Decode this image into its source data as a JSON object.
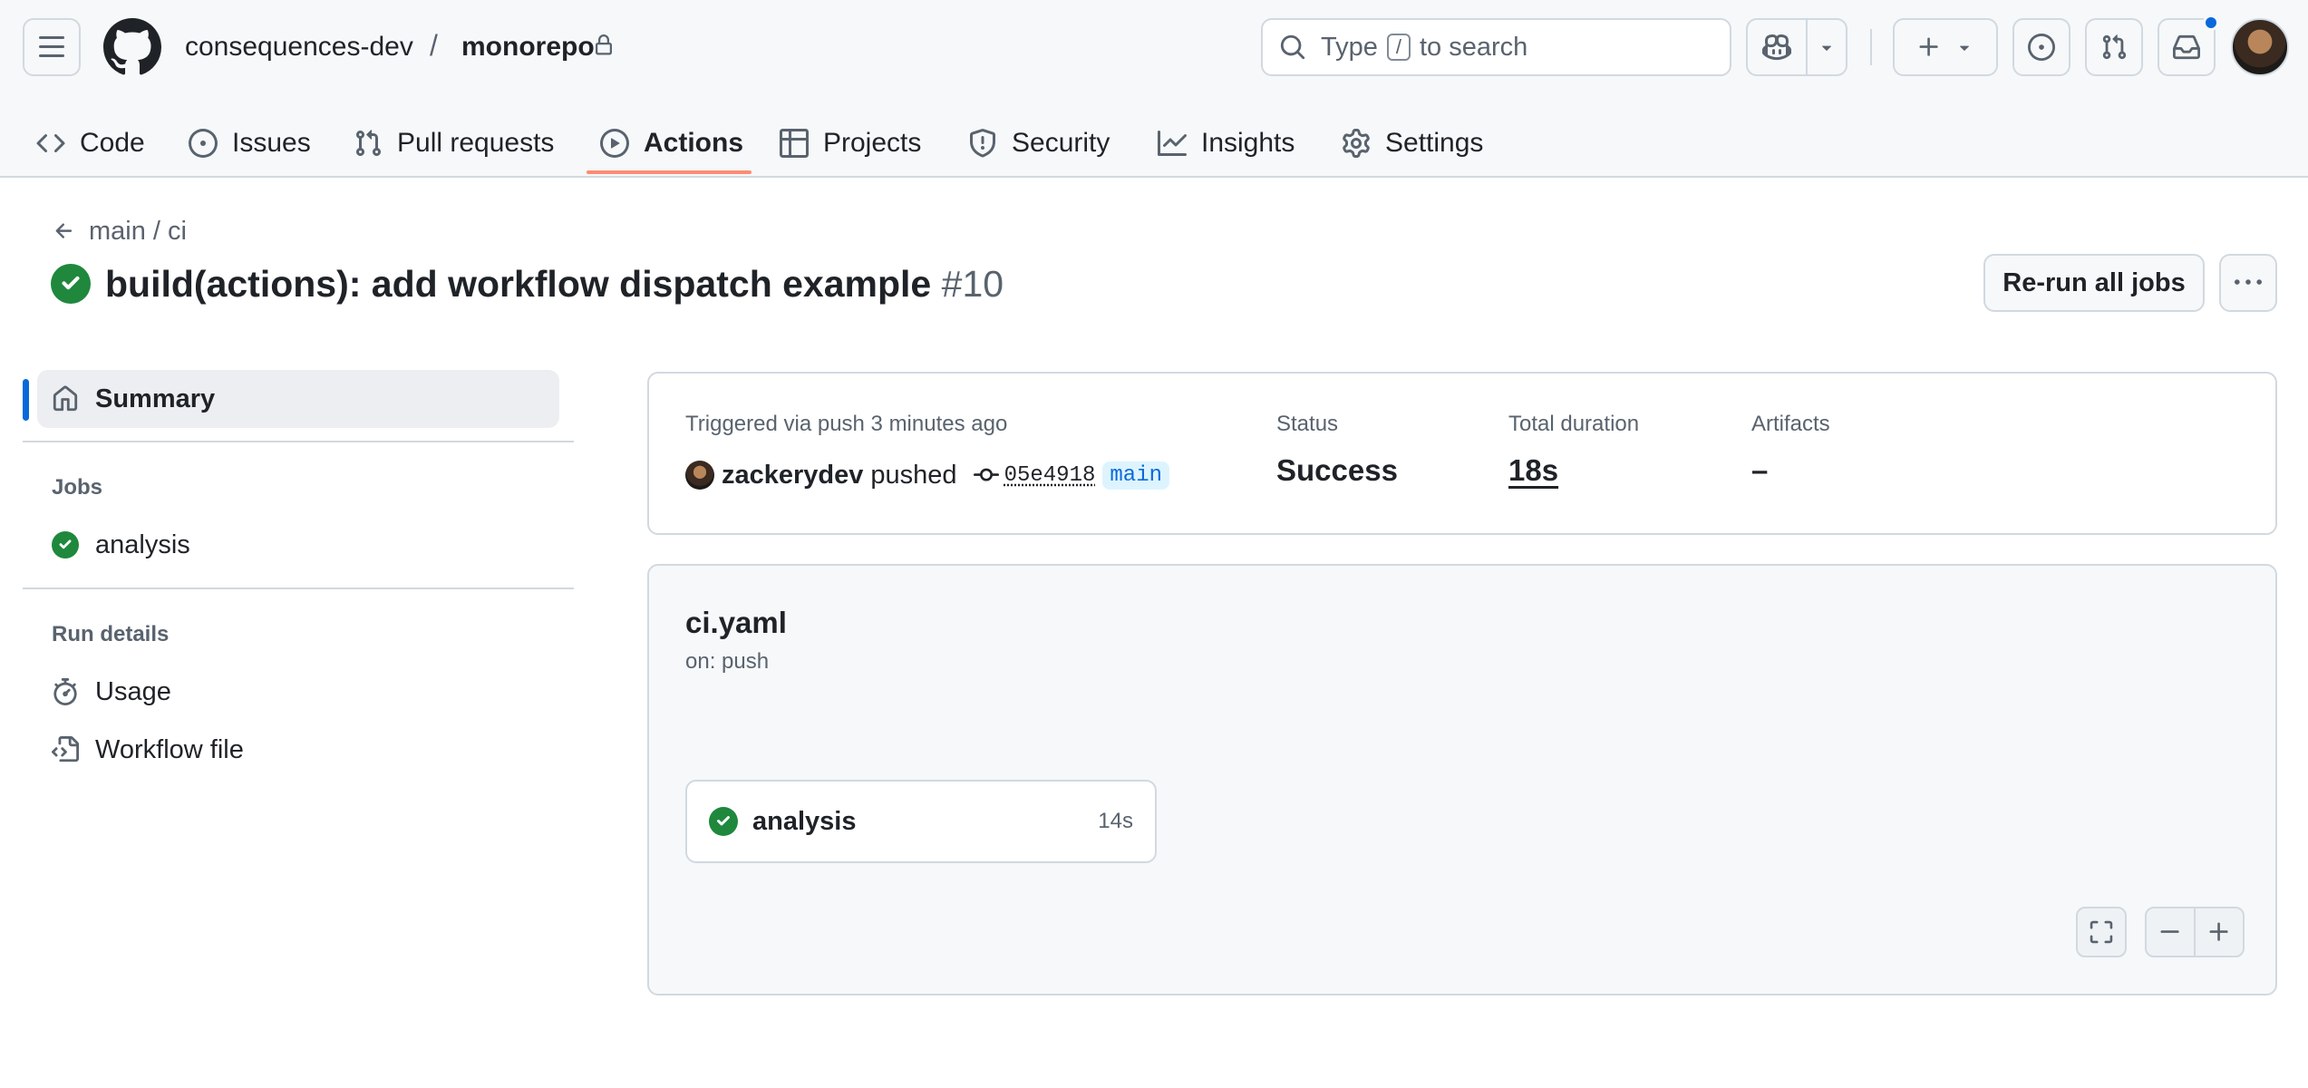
{
  "header": {
    "owner": "consequences-dev",
    "separator": "/",
    "repo": "monorepo",
    "search": {
      "prefix": "Type",
      "key": "/",
      "suffix": "to search"
    }
  },
  "repo_nav": [
    {
      "label": "Code",
      "icon": "code-icon"
    },
    {
      "label": "Issues",
      "icon": "issue-opened-icon"
    },
    {
      "label": "Pull requests",
      "icon": "git-pull-request-icon"
    },
    {
      "label": "Actions",
      "icon": "play-icon",
      "active": true
    },
    {
      "label": "Projects",
      "icon": "table-icon"
    },
    {
      "label": "Security",
      "icon": "shield-icon"
    },
    {
      "label": "Insights",
      "icon": "graph-icon"
    },
    {
      "label": "Settings",
      "icon": "gear-icon"
    }
  ],
  "page": {
    "breadcrumb": "main / ci",
    "title": "build(actions): add workflow dispatch example",
    "run_number": "#10",
    "rerun_label": "Re-run all jobs"
  },
  "sidebar": {
    "summary_label": "Summary",
    "jobs_heading": "Jobs",
    "jobs": [
      {
        "label": "analysis",
        "status": "success"
      }
    ],
    "run_details_heading": "Run details",
    "run_details": [
      {
        "label": "Usage",
        "icon": "stopwatch-icon"
      },
      {
        "label": "Workflow file",
        "icon": "file-code-icon"
      }
    ]
  },
  "summary": {
    "trigger_text": "Triggered via push 3 minutes ago",
    "pusher": "zackerydev",
    "pushed_word": "pushed",
    "commit": "05e4918",
    "branch": "main",
    "status_label": "Status",
    "status_value": "Success",
    "duration_label": "Total duration",
    "duration_value": "18s",
    "artifacts_label": "Artifacts",
    "artifacts_value": "–"
  },
  "graph": {
    "workflow_file": "ci.yaml",
    "trigger": "on: push",
    "jobs": [
      {
        "label": "analysis",
        "duration": "14s",
        "status": "success"
      }
    ]
  },
  "colors": {
    "accent": "#0969da",
    "success": "#1f883d",
    "tab_underline": "#fd8c73"
  }
}
